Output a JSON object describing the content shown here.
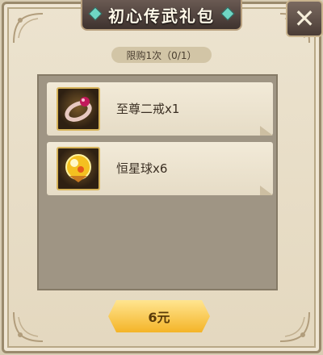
{
  "window": {
    "title": "初心传武礼包"
  },
  "limit": {
    "text": "限购1次（0/1）"
  },
  "items": [
    {
      "name": "至尊二戒x1",
      "icon": "ring-icon"
    },
    {
      "name": "恒星球x6",
      "icon": "star-orb-icon"
    }
  ],
  "buy": {
    "label": "6元"
  },
  "close": {
    "icon": "close-icon"
  },
  "colors": {
    "frame": "#e4d8bf",
    "title_plate": "#4e403a",
    "panel": "#9f9584",
    "buy_button": "#f4b428",
    "gem": "#6fd6c4"
  }
}
